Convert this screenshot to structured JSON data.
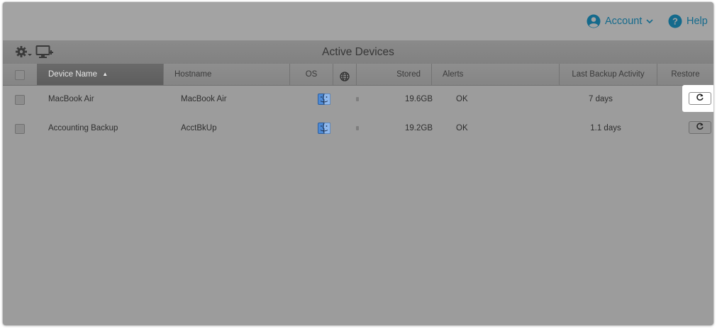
{
  "header": {
    "account_label": "Account",
    "help_label": "Help",
    "link_color": "#146a8c"
  },
  "toolbar": {
    "settings_icon": "gear-dropdown-icon",
    "add_device_icon": "monitor-add-icon"
  },
  "page": {
    "title": "Active Devices"
  },
  "table": {
    "columns": {
      "device_name": "Device Name",
      "hostname": "Hostname",
      "os": "OS",
      "network_icon": "globe-icon",
      "stored": "Stored",
      "alerts": "Alerts",
      "last_backup": "Last Backup Activity",
      "restore": "Restore"
    },
    "sort": {
      "column": "Device Name",
      "direction": "ascending"
    },
    "rows": [
      {
        "device_name": "MacBook Air",
        "hostname": "MacBook Air",
        "os_icon": "mac-finder-icon",
        "stored": "19.6GB",
        "alerts": "OK",
        "last_backup": "7 days",
        "restore_icon": "restore-icon"
      },
      {
        "device_name": "Accounting Backup",
        "hostname": "AcctBkUp",
        "os_icon": "mac-finder-icon",
        "stored": "19.2GB",
        "alerts": "OK",
        "last_backup": "1.1 days",
        "restore_icon": "restore-icon"
      }
    ]
  }
}
